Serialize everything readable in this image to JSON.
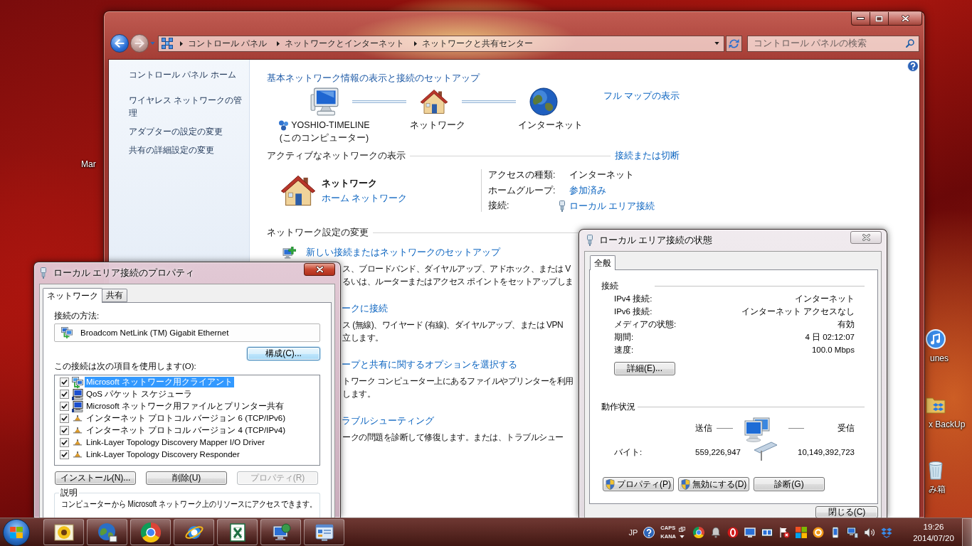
{
  "desktop": {
    "icons": [
      {
        "kind": "shortcut",
        "label": "Mar"
      },
      {
        "kind": "music",
        "label": "unes"
      },
      {
        "kind": "folder",
        "label": "x BackUp"
      },
      {
        "kind": "bin",
        "label": "み箱"
      }
    ]
  },
  "explorer": {
    "address_bar": {
      "breadcrumbs": [
        "コントロール パネル",
        "ネットワークとインターネット",
        "ネットワークと共有センター"
      ]
    },
    "search": {
      "placeholder": "コントロール パネルの検索"
    },
    "sidebar": {
      "items": [
        "コントロール パネル ホーム",
        "ワイヤレス ネットワークの管理",
        "アダプターの設定の変更",
        "共有の詳細設定の変更"
      ]
    },
    "heading": "基本ネットワーク情報の表示と接続のセットアップ",
    "map": {
      "nodes": [
        {
          "kind": "computer",
          "label": "YOSHIO-TIMELINE",
          "sublabel": "(このコンピューター)"
        },
        {
          "kind": "network",
          "label": "ネットワーク"
        },
        {
          "kind": "internet",
          "label": "インターネット"
        }
      ],
      "full_map_link": "フル マップの表示"
    },
    "active_networks": {
      "heading": "アクティブなネットワークの表示",
      "link": "接続または切断",
      "network": {
        "name": "ネットワーク",
        "type": "ホーム ネットワーク"
      },
      "details": [
        {
          "kind": "text",
          "label": "アクセスの種類:",
          "value": "インターネット"
        },
        {
          "kind": "link",
          "label": "ホームグループ:",
          "value": "参加済み"
        },
        {
          "kind": "connection",
          "label": "接続:",
          "value": "ローカル エリア接続"
        }
      ]
    },
    "change_settings": {
      "heading": "ネットワーク設定の変更",
      "tasks": [
        {
          "kind": "full",
          "link": "新しい接続またはネットワークのセットアップ",
          "lines": [
            "ス、ブロードバンド、ダイヤルアップ、アドホック、または V",
            "るいは、ルーターまたはアクセス ポイントをセットアップしま"
          ]
        },
        {
          "kind": "covered",
          "link": "ークに接続",
          "lines": [
            "ス (無線)、ワイヤード (有線)、ダイヤルアップ、または VPN",
            "立します。"
          ]
        },
        {
          "kind": "covered",
          "link": "ープと共有に関するオプションを選択する",
          "lines": [
            "トワーク コンピューター上にあるファイルやプリンターを利用",
            "します。"
          ]
        },
        {
          "kind": "covered",
          "link": "ラブルシューティング",
          "lines": [
            "ークの問題を診断して修復します。または、トラブルシュー"
          ]
        }
      ]
    }
  },
  "properties_dialog": {
    "title": "ローカル エリア接続のプロパティ",
    "tabs": [
      {
        "label": "ネットワーク",
        "selected": true
      },
      {
        "label": "共有",
        "selected": false
      }
    ],
    "connect_using": {
      "label": "接続の方法:",
      "adapter": "Broadcom NetLink (TM) Gigabit Ethernet"
    },
    "configure_button": {
      "label": "構成(C)...",
      "focused": true
    },
    "items_label": "この接続は次の項目を使用します(O):",
    "items": [
      {
        "kind": "client",
        "label": "Microsoft ネットワーク用クライアント",
        "checked": true,
        "selected": true
      },
      {
        "kind": "service",
        "label": "QoS パケット スケジューラ",
        "checked": true,
        "selected": false
      },
      {
        "kind": "service",
        "label": "Microsoft ネットワーク用ファイルとプリンター共有",
        "checked": true,
        "selected": false
      },
      {
        "kind": "protocol",
        "label": "インターネット プロトコル バージョン 6 (TCP/IPv6)",
        "checked": true,
        "selected": false
      },
      {
        "kind": "protocol",
        "label": "インターネット プロトコル バージョン 4 (TCP/IPv4)",
        "checked": true,
        "selected": false
      },
      {
        "kind": "protocol",
        "label": "Link-Layer Topology Discovery Mapper I/O Driver",
        "checked": true,
        "selected": false
      },
      {
        "kind": "protocol",
        "label": "Link-Layer Topology Discovery Responder",
        "checked": true,
        "selected": false
      }
    ],
    "buttons": [
      {
        "label": "インストール(N)...",
        "disabled": false
      },
      {
        "label": "削除(U)",
        "disabled": false
      },
      {
        "label": "プロパティ(R)",
        "disabled": true
      }
    ],
    "description": {
      "heading": "説明",
      "text": "コンピューターから Microsoft ネットワーク上のリソースにアクセスできます。"
    }
  },
  "status_dialog": {
    "title": "ローカル エリア接続の状態",
    "tabs": [
      {
        "label": "全般",
        "selected": true
      }
    ],
    "connection": {
      "heading": "接続",
      "rows": [
        {
          "label": "IPv4 接続:",
          "value": "インターネット"
        },
        {
          "label": "IPv6 接続:",
          "value": "インターネット アクセスなし"
        },
        {
          "label": "メディアの状態:",
          "value": "有効"
        },
        {
          "label": "期間:",
          "value": "4 日 02:12:07"
        },
        {
          "label": "速度:",
          "value": "100.0 Mbps"
        }
      ]
    },
    "details_button": "詳細(E)...",
    "activity": {
      "heading": "動作状況",
      "sent_label": "送信",
      "received_label": "受信",
      "bytes_label": "バイト:",
      "bytes_sent": "559,226,947",
      "bytes_received": "10,149,392,723"
    },
    "buttons": [
      {
        "label": "プロパティ(P)",
        "shield": true
      },
      {
        "label": "無効にする(D)",
        "shield": true
      },
      {
        "label": "診断(G)",
        "shield": false
      }
    ],
    "close_button": "閉じる(C)"
  },
  "taskbar": {
    "apps": [
      {
        "kind": "sunflower"
      },
      {
        "kind": "globe"
      },
      {
        "kind": "wheel"
      },
      {
        "kind": "orbit"
      },
      {
        "kind": "sheet"
      },
      {
        "kind": "network"
      },
      {
        "kind": "panel"
      }
    ],
    "tray": {
      "language": "JP",
      "caps": "CAPS",
      "kana": "KANA",
      "icons": [
        {
          "kind": "wheel"
        },
        {
          "kind": "bell"
        },
        {
          "kind": "red-ring"
        },
        {
          "kind": "display"
        },
        {
          "kind": "card"
        },
        {
          "kind": "flag"
        },
        {
          "kind": "squares"
        },
        {
          "kind": "orange-ring"
        },
        {
          "kind": "device"
        },
        {
          "kind": "network"
        },
        {
          "kind": "speaker"
        },
        {
          "kind": "box"
        }
      ],
      "time": "19:26",
      "date": "2014/07/20"
    }
  }
}
